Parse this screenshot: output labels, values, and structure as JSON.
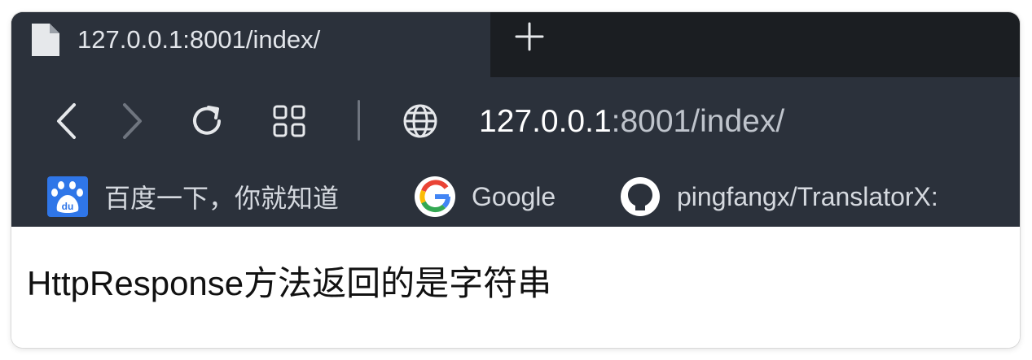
{
  "tab": {
    "title": "127.0.0.1:8001/index/"
  },
  "toolbar": {
    "back_icon": "back-arrow-icon",
    "forward_icon": "forward-arrow-icon",
    "reload_icon": "reload-icon",
    "apps_icon": "apps-grid-icon",
    "site_icon": "globe-icon"
  },
  "address_bar": {
    "host": "127.0.0.1",
    "rest": ":8001/index/"
  },
  "bookmarks": [
    {
      "label": "百度一下，你就知道",
      "icon": "baidu-icon"
    },
    {
      "label": "Google",
      "icon": "google-icon"
    },
    {
      "label": "pingfangx/TranslatorX:",
      "icon": "github-icon"
    }
  ],
  "page": {
    "body_text": "HttpResponse方法返回的是字符串"
  },
  "colors": {
    "tabstrip_bg": "#1b1e22",
    "toolbar_bg": "#2b313b",
    "url_host": "#ffffff",
    "url_rest": "#bfc4cc",
    "page_bg": "#ffffff"
  }
}
